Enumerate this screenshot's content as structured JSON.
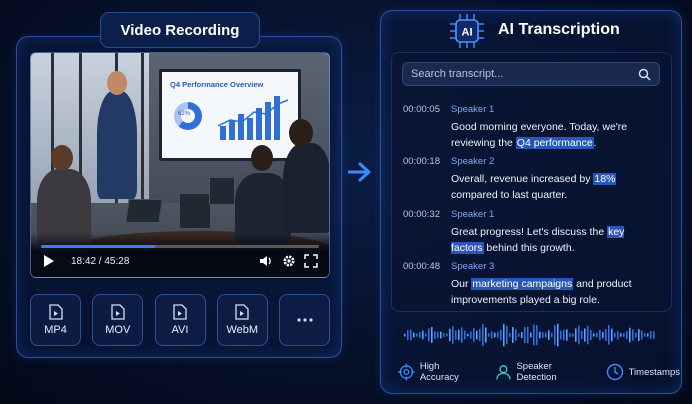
{
  "left_panel": {
    "title": "Video Recording",
    "screen_title": "Q4 Performance Overview",
    "donut_label": "62%",
    "timecode": "18:42 / 45:28",
    "progress_fraction": 0.41,
    "formats": [
      "MP4",
      "MOV",
      "AVI",
      "WebM"
    ],
    "more_icon": "ellipsis-icon"
  },
  "right_panel": {
    "title": "AI Transcription",
    "badge": "AI",
    "search_placeholder": "Search transcript...",
    "entries": [
      {
        "time": "00:00:05",
        "speaker": "Speaker 1",
        "text_before": "Good morning everyone. Today, we're reviewing the ",
        "highlight": "Q4 performance",
        "text_after": "."
      },
      {
        "time": "00:00:18",
        "speaker": "Speaker 2",
        "text_before": "Overall, revenue increased by ",
        "highlight": "18%",
        "text_after": " compared to last quarter."
      },
      {
        "time": "00:00:32",
        "speaker": "Speaker 1",
        "text_before": "Great progress! Let's discuss the ",
        "highlight": "key factors",
        "text_after": " behind this growth."
      },
      {
        "time": "00:00:48",
        "speaker": "Speaker 3",
        "text_before": "Our ",
        "highlight": "marketing campaigns",
        "text_after": " and product improvements played a big role."
      }
    ],
    "features": [
      "High Accuracy",
      "Speaker Detection",
      "Timestamps"
    ]
  },
  "colors": {
    "accent": "#3a7bff",
    "highlight": "#2857b8",
    "panel_border": "#4c82eb"
  }
}
